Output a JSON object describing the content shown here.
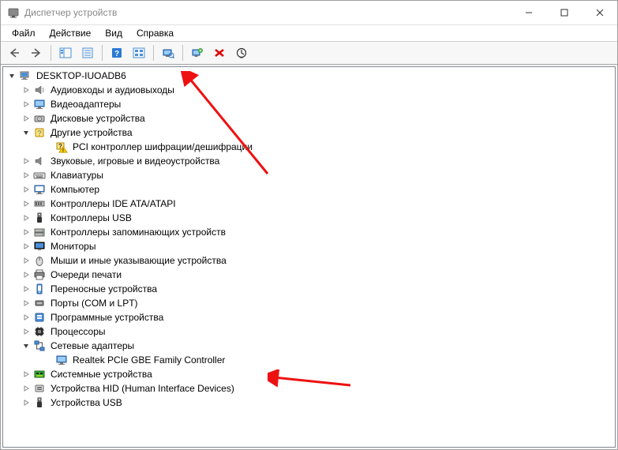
{
  "window": {
    "title": "Диспетчер устройств"
  },
  "menu": {
    "file": "Файл",
    "action": "Действие",
    "view": "Вид",
    "help": "Справка"
  },
  "tree": {
    "root": "DESKTOP-IUOADB6",
    "nodes": [
      {
        "label": "Аудиовходы и аудиовыходы",
        "icon": "audio"
      },
      {
        "label": "Видеоадаптеры",
        "icon": "display"
      },
      {
        "label": "Дисковые устройства",
        "icon": "disk"
      },
      {
        "label": "Другие устройства",
        "icon": "unknown",
        "expanded": true,
        "children": [
          {
            "label": "PCI контроллер шифрации/дешифрации",
            "icon": "warning"
          }
        ]
      },
      {
        "label": "Звуковые, игровые и видеоустройства",
        "icon": "sound"
      },
      {
        "label": "Клавиатуры",
        "icon": "keyboard"
      },
      {
        "label": "Компьютер",
        "icon": "computer"
      },
      {
        "label": "Контроллеры IDE ATA/ATAPI",
        "icon": "ide"
      },
      {
        "label": "Контроллеры USB",
        "icon": "usb"
      },
      {
        "label": "Контроллеры запоминающих устройств",
        "icon": "storage"
      },
      {
        "label": "Мониторы",
        "icon": "monitor"
      },
      {
        "label": "Мыши и иные указывающие устройства",
        "icon": "mouse"
      },
      {
        "label": "Очереди печати",
        "icon": "printer"
      },
      {
        "label": "Переносные устройства",
        "icon": "portable"
      },
      {
        "label": "Порты (COM и LPT)",
        "icon": "port"
      },
      {
        "label": "Программные устройства",
        "icon": "software"
      },
      {
        "label": "Процессоры",
        "icon": "cpu"
      },
      {
        "label": "Сетевые адаптеры",
        "icon": "network",
        "expanded": true,
        "children": [
          {
            "label": "Realtek PCIe GBE Family Controller",
            "icon": "netcard"
          }
        ]
      },
      {
        "label": "Системные устройства",
        "icon": "system"
      },
      {
        "label": "Устройства HID (Human Interface Devices)",
        "icon": "hid"
      },
      {
        "label": "Устройства USB",
        "icon": "usb2"
      }
    ]
  }
}
